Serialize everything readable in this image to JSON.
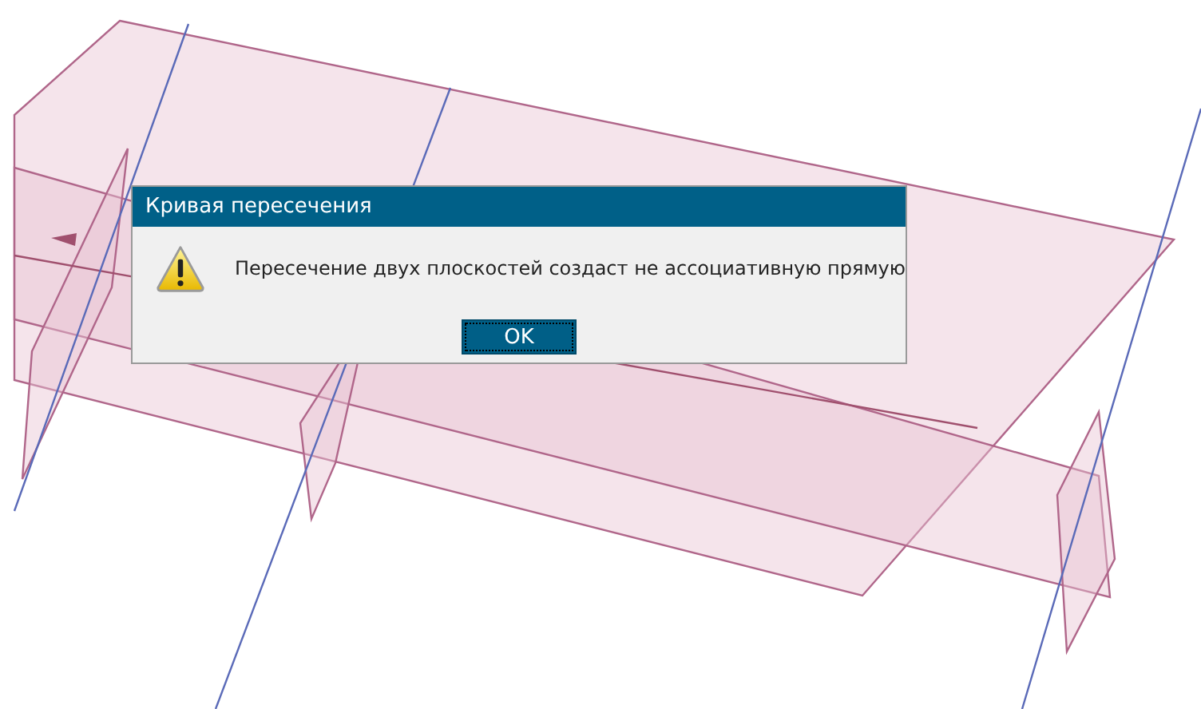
{
  "dialog": {
    "title": "Кривая пересечения",
    "message": "Пересечение двух плоскостей создаст не ассоциативную прямую",
    "buttons": [
      {
        "label": "OK",
        "focused": true
      }
    ]
  }
}
